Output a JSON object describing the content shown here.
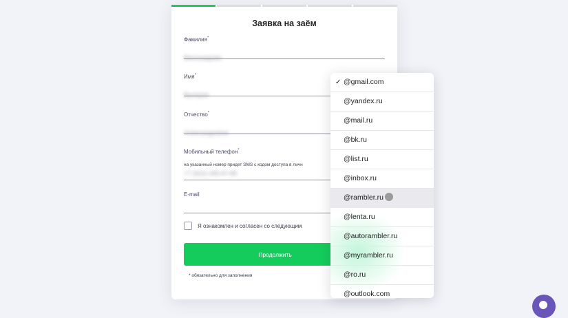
{
  "form": {
    "title": "Заявка на заём",
    "progress": {
      "steps_total": 5,
      "steps_done": 1
    },
    "fields": {
      "surname": {
        "label": "Фамилия",
        "required_mark": "*",
        "value": "Виноградова"
      },
      "name": {
        "label": "Имя",
        "required_mark": "*",
        "value": "Валерия"
      },
      "patronymic": {
        "label": "Отчество",
        "required_mark": "*",
        "value": "Александровна"
      },
      "phone": {
        "label": "Мобильный телефон",
        "required_mark": "*",
        "hint": "на указанный номер придет SMS с кодом доступа в личн",
        "value": "+7 (912) 345-67-89"
      },
      "email": {
        "label": "E-mail",
        "value": ""
      }
    },
    "agreement_label": "Я ознакомлен и согласен со следующим",
    "submit_label": "Продолжить",
    "footnote": "* обязательно для заполнения"
  },
  "email_domains": {
    "options": [
      "@gmail.com",
      "@yandex.ru",
      "@mail.ru",
      "@bk.ru",
      "@list.ru",
      "@inbox.ru",
      "@rambler.ru",
      "@lenta.ru",
      "@autorambler.ru",
      "@myrambler.ru",
      "@ro.ru",
      "@outlook.com"
    ],
    "selected": "@gmail.com",
    "hovered": "@rambler.ru",
    "check_mark": "✓"
  },
  "colors": {
    "accent": "#14cc5b",
    "progress_done": "#1fc95a",
    "chat": "#6a55b8"
  },
  "icons": {
    "chat": "chat-bubble-icon",
    "checkmark": "check-icon"
  }
}
